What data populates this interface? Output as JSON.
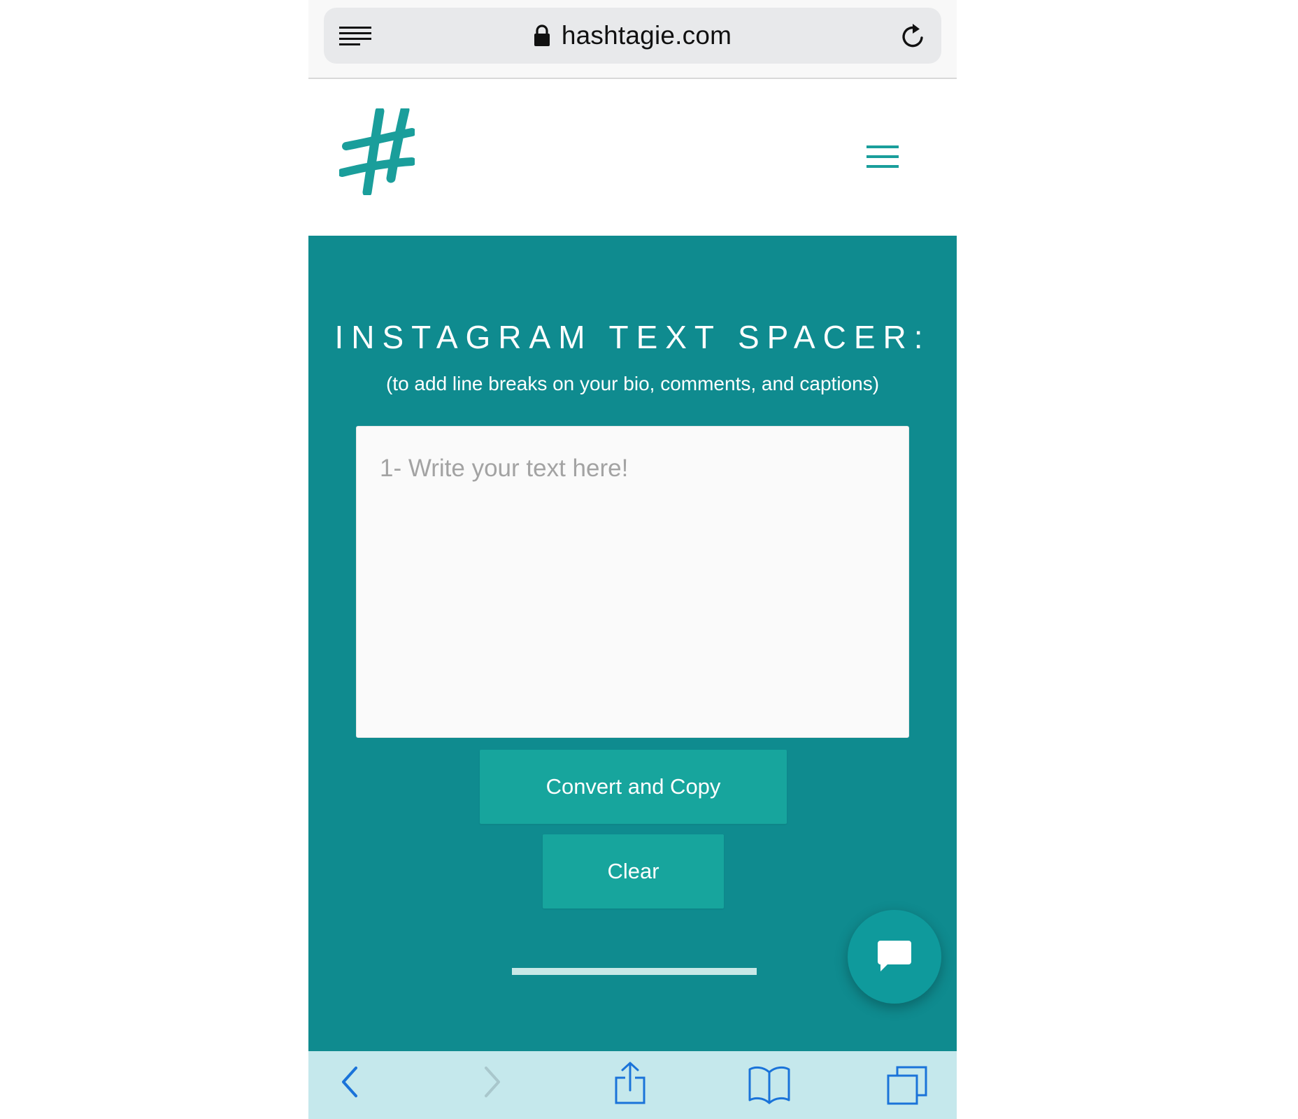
{
  "browser": {
    "url": "hashtagie.com",
    "icons": {
      "reader": "reader-icon",
      "lock": "lock-icon",
      "reload": "reload-icon"
    }
  },
  "header": {
    "logo_icon": "hashtag-logo",
    "menu_icon": "menu-icon"
  },
  "main": {
    "title": "INSTAGRAM TEXT SPACER:",
    "subtitle": "(to add line breaks on your bio, comments, and captions)",
    "textarea": {
      "value": "",
      "placeholder": "1- Write your text here!"
    },
    "convert_button": "Convert and Copy",
    "clear_button": "Clear",
    "chat_icon": "chat-icon"
  },
  "toolbar": {
    "icons": [
      "back-icon",
      "forward-icon",
      "share-icon",
      "bookmarks-icon",
      "tabs-icon"
    ]
  },
  "colors": {
    "teal_bg": "#0f8b8f",
    "button": "#17a59d",
    "accent": "#1a9e9b",
    "toolbar_bg": "#c5e8ec",
    "ios_blue": "#1a73d9"
  }
}
